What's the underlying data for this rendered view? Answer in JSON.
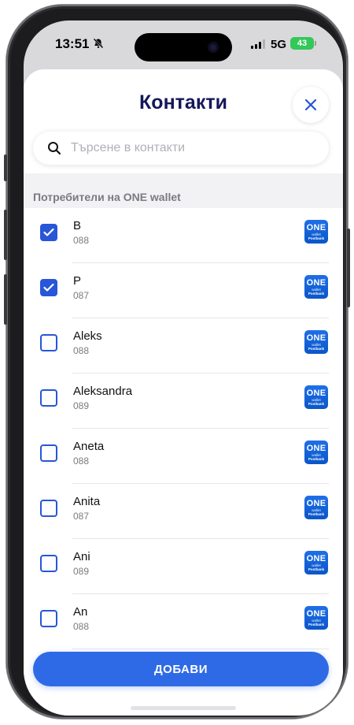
{
  "status_bar": {
    "time": "13:51",
    "network": "5G",
    "battery": "43"
  },
  "header": {
    "title": "Контакти"
  },
  "search": {
    "placeholder": "Търсене в контакти"
  },
  "section": {
    "title": "Потребители на ONE wallet"
  },
  "badge": {
    "label": "ONE",
    "sub": "wallet",
    "bank": "Postbank"
  },
  "contacts": [
    {
      "name": "В",
      "phone": "088",
      "checked": true
    },
    {
      "name": "Р",
      "phone": "087",
      "checked": true
    },
    {
      "name": "Aleks",
      "phone": "088",
      "checked": false
    },
    {
      "name": "Aleksandra",
      "phone": "089",
      "checked": false
    },
    {
      "name": "Aneta",
      "phone": "088",
      "checked": false
    },
    {
      "name": "Anita",
      "phone": "087",
      "checked": false
    },
    {
      "name": "Ani",
      "phone": "089",
      "checked": false
    },
    {
      "name": "An",
      "phone": "088",
      "checked": false
    }
  ],
  "actions": {
    "add_label": "ДОБАВИ"
  },
  "colors": {
    "accent": "#2756d8",
    "title": "#14185a",
    "button": "#2f6ae6"
  }
}
